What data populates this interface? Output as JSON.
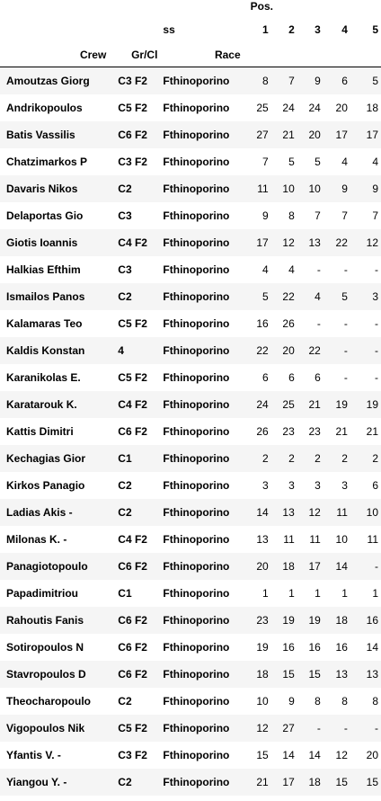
{
  "header": {
    "pos_label": "Pos.",
    "ss_label": "ss",
    "crew_label": "Crew",
    "grcl_label": "Gr/Cl",
    "race_label": "Race",
    "pos_columns": [
      "1",
      "2",
      "3",
      "4",
      "5"
    ]
  },
  "rows": [
    {
      "crew": "Amoutzas Giorg",
      "grcl": "C3 F2",
      "race": "Fthinoporino",
      "pos": [
        "8",
        "7",
        "9",
        "6",
        "5"
      ]
    },
    {
      "crew": "Andrikopoulos",
      "grcl": "C5 F2",
      "race": "Fthinoporino",
      "pos": [
        "25",
        "24",
        "24",
        "20",
        "18"
      ]
    },
    {
      "crew": "Batis Vassilis",
      "grcl": "C6 F2",
      "race": "Fthinoporino",
      "pos": [
        "27",
        "21",
        "20",
        "17",
        "17"
      ]
    },
    {
      "crew": "Chatzimarkos P",
      "grcl": "C3 F2",
      "race": "Fthinoporino",
      "pos": [
        "7",
        "5",
        "5",
        "4",
        "4"
      ]
    },
    {
      "crew": "Davaris Nikos",
      "grcl": "C2",
      "race": "Fthinoporino",
      "pos": [
        "11",
        "10",
        "10",
        "9",
        "9"
      ]
    },
    {
      "crew": "Delaportas Gio",
      "grcl": "C3",
      "race": "Fthinoporino",
      "pos": [
        "9",
        "8",
        "7",
        "7",
        "7"
      ]
    },
    {
      "crew": "Giotis Ioannis",
      "grcl": "C4 F2",
      "race": "Fthinoporino",
      "pos": [
        "17",
        "12",
        "13",
        "22",
        "12"
      ]
    },
    {
      "crew": "Halkias Efthim",
      "grcl": "C3",
      "race": "Fthinoporino",
      "pos": [
        "4",
        "4",
        "-",
        "-",
        "-"
      ]
    },
    {
      "crew": "Ismailos Panos",
      "grcl": "C2",
      "race": "Fthinoporino",
      "pos": [
        "5",
        "22",
        "4",
        "5",
        "3"
      ]
    },
    {
      "crew": "Kalamaras Teo",
      "grcl": "C5 F2",
      "race": "Fthinoporino",
      "pos": [
        "16",
        "26",
        "-",
        "-",
        "-"
      ]
    },
    {
      "crew": "Kaldis Konstan",
      "grcl": "4",
      "race": "Fthinoporino",
      "pos": [
        "22",
        "20",
        "22",
        "-",
        "-"
      ]
    },
    {
      "crew": "Karanikolas E.",
      "grcl": "C5 F2",
      "race": "Fthinoporino",
      "pos": [
        "6",
        "6",
        "6",
        "-",
        "-"
      ]
    },
    {
      "crew": "Karatarouk K.",
      "grcl": "C4 F2",
      "race": "Fthinoporino",
      "pos": [
        "24",
        "25",
        "21",
        "19",
        "19"
      ]
    },
    {
      "crew": "Kattis Dimitri",
      "grcl": "C6 F2",
      "race": "Fthinoporino",
      "pos": [
        "26",
        "23",
        "23",
        "21",
        "21"
      ]
    },
    {
      "crew": "Kechagias Gior",
      "grcl": "C1",
      "race": "Fthinoporino",
      "pos": [
        "2",
        "2",
        "2",
        "2",
        "2"
      ]
    },
    {
      "crew": "Kirkos Panagio",
      "grcl": "C2",
      "race": "Fthinoporino",
      "pos": [
        "3",
        "3",
        "3",
        "3",
        "6"
      ]
    },
    {
      "crew": "Ladias Akis -",
      "grcl": "C2",
      "race": "Fthinoporino",
      "pos": [
        "14",
        "13",
        "12",
        "11",
        "10"
      ]
    },
    {
      "crew": "Milonas K. -",
      "grcl": "C4 F2",
      "race": "Fthinoporino",
      "pos": [
        "13",
        "11",
        "11",
        "10",
        "11"
      ]
    },
    {
      "crew": "Panagiotopoulo",
      "grcl": "C6 F2",
      "race": "Fthinoporino",
      "pos": [
        "20",
        "18",
        "17",
        "14",
        "-"
      ]
    },
    {
      "crew": "Papadimitriou",
      "grcl": "C1",
      "race": "Fthinoporino",
      "pos": [
        "1",
        "1",
        "1",
        "1",
        "1"
      ]
    },
    {
      "crew": "Rahoutis Fanis",
      "grcl": "C6 F2",
      "race": "Fthinoporino",
      "pos": [
        "23",
        "19",
        "19",
        "18",
        "16"
      ]
    },
    {
      "crew": "Sotiropoulos N",
      "grcl": "C6 F2",
      "race": "Fthinoporino",
      "pos": [
        "19",
        "16",
        "16",
        "16",
        "14"
      ]
    },
    {
      "crew": "Stavropoulos D",
      "grcl": "C6 F2",
      "race": "Fthinoporino",
      "pos": [
        "18",
        "15",
        "15",
        "13",
        "13"
      ]
    },
    {
      "crew": "Theocharopoulo",
      "grcl": "C2",
      "race": "Fthinoporino",
      "pos": [
        "10",
        "9",
        "8",
        "8",
        "8"
      ]
    },
    {
      "crew": "Vigopoulos Nik",
      "grcl": "C5 F2",
      "race": "Fthinoporino",
      "pos": [
        "12",
        "27",
        "-",
        "-",
        "-"
      ]
    },
    {
      "crew": "Yfantis V. -",
      "grcl": "C3 F2",
      "race": "Fthinoporino",
      "pos": [
        "15",
        "14",
        "14",
        "12",
        "20"
      ]
    },
    {
      "crew": "Yiangou Y. -",
      "grcl": "C2",
      "race": "Fthinoporino",
      "pos": [
        "21",
        "17",
        "18",
        "15",
        "15"
      ]
    }
  ]
}
